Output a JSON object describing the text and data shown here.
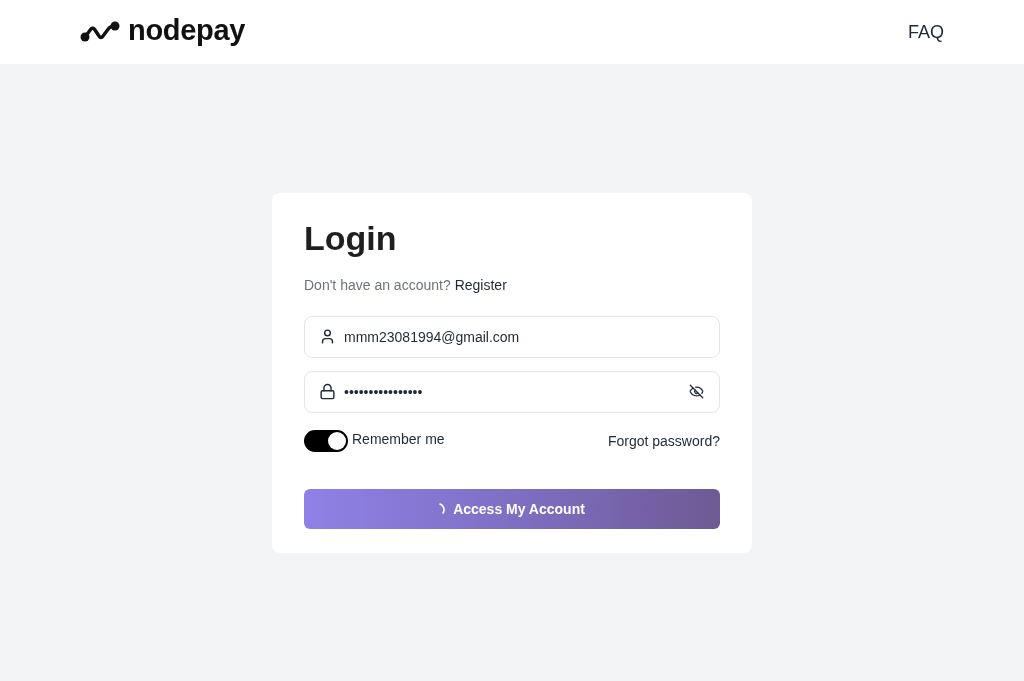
{
  "header": {
    "logo": {
      "wordmark": "nodepay"
    },
    "nav": [
      {
        "label": "FAQ"
      }
    ]
  },
  "login": {
    "title": "Login",
    "prompt": {
      "text": "Don't have an account?",
      "link": "Register"
    },
    "fields": [
      {
        "kind": "email",
        "value": "mmm23081994@gmail.com"
      },
      {
        "kind": "password",
        "value": "••••••••••••••••",
        "reveal": false
      }
    ],
    "remember": {
      "label": "Remember me",
      "checked": true
    },
    "forgot": "Forgot password?",
    "submit": {
      "label": "Access My Account",
      "loading": true
    }
  }
}
